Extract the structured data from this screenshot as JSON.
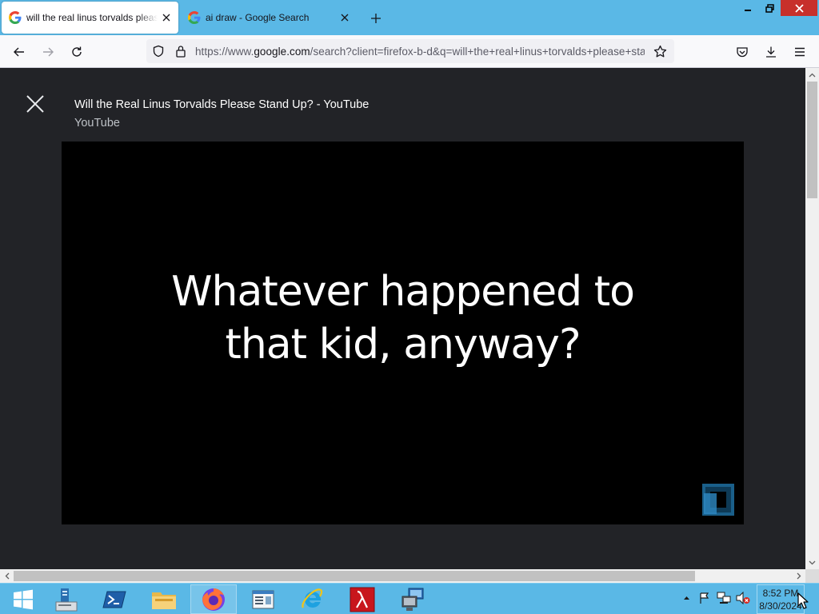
{
  "window": {
    "tabs": [
      {
        "title": "will the real linus torvalds please stand up - Google Search",
        "favicon": "google-g-icon",
        "active": true
      },
      {
        "title": "ai draw - Google Search",
        "favicon": "google-g-icon",
        "active": false
      }
    ],
    "controls": [
      "minimize-icon",
      "restore-icon",
      "close-icon"
    ]
  },
  "navbar": {
    "url_scheme": "https://www.",
    "url_host": "google.com",
    "url_path": "/search?client=firefox-b-d&q=will+the+real+linus+torvalds+please+stand+up",
    "icons": [
      "back-icon",
      "forward-icon",
      "reload-icon",
      "tracking-shield-icon",
      "lock-icon",
      "bookmark-star-icon",
      "pocket-icon",
      "downloads-icon",
      "menu-icon"
    ]
  },
  "lightbox": {
    "title": "Will the Real Linus Torvalds Please Stand Up? - YouTube",
    "source": "YouTube",
    "video_caption_line1": "Whatever happened to",
    "video_caption_line2": "that kid, anyway?"
  },
  "taskbar": {
    "apps": [
      "windows-start-icon",
      "server-manager-icon",
      "powershell-icon",
      "file-explorer-icon",
      "firefox-icon",
      "notepad-icon",
      "internet-explorer-icon",
      "lambda-app-icon",
      "remote-desktop-icon"
    ],
    "clock_time": "8:52 PM",
    "clock_date": "8/30/2024"
  },
  "colors": {
    "titlebar": "#5ab8e6",
    "taskbar": "#5ab8e6",
    "content_bg": "#222327",
    "video_bg": "#000000",
    "close_button": "#c7302b"
  }
}
